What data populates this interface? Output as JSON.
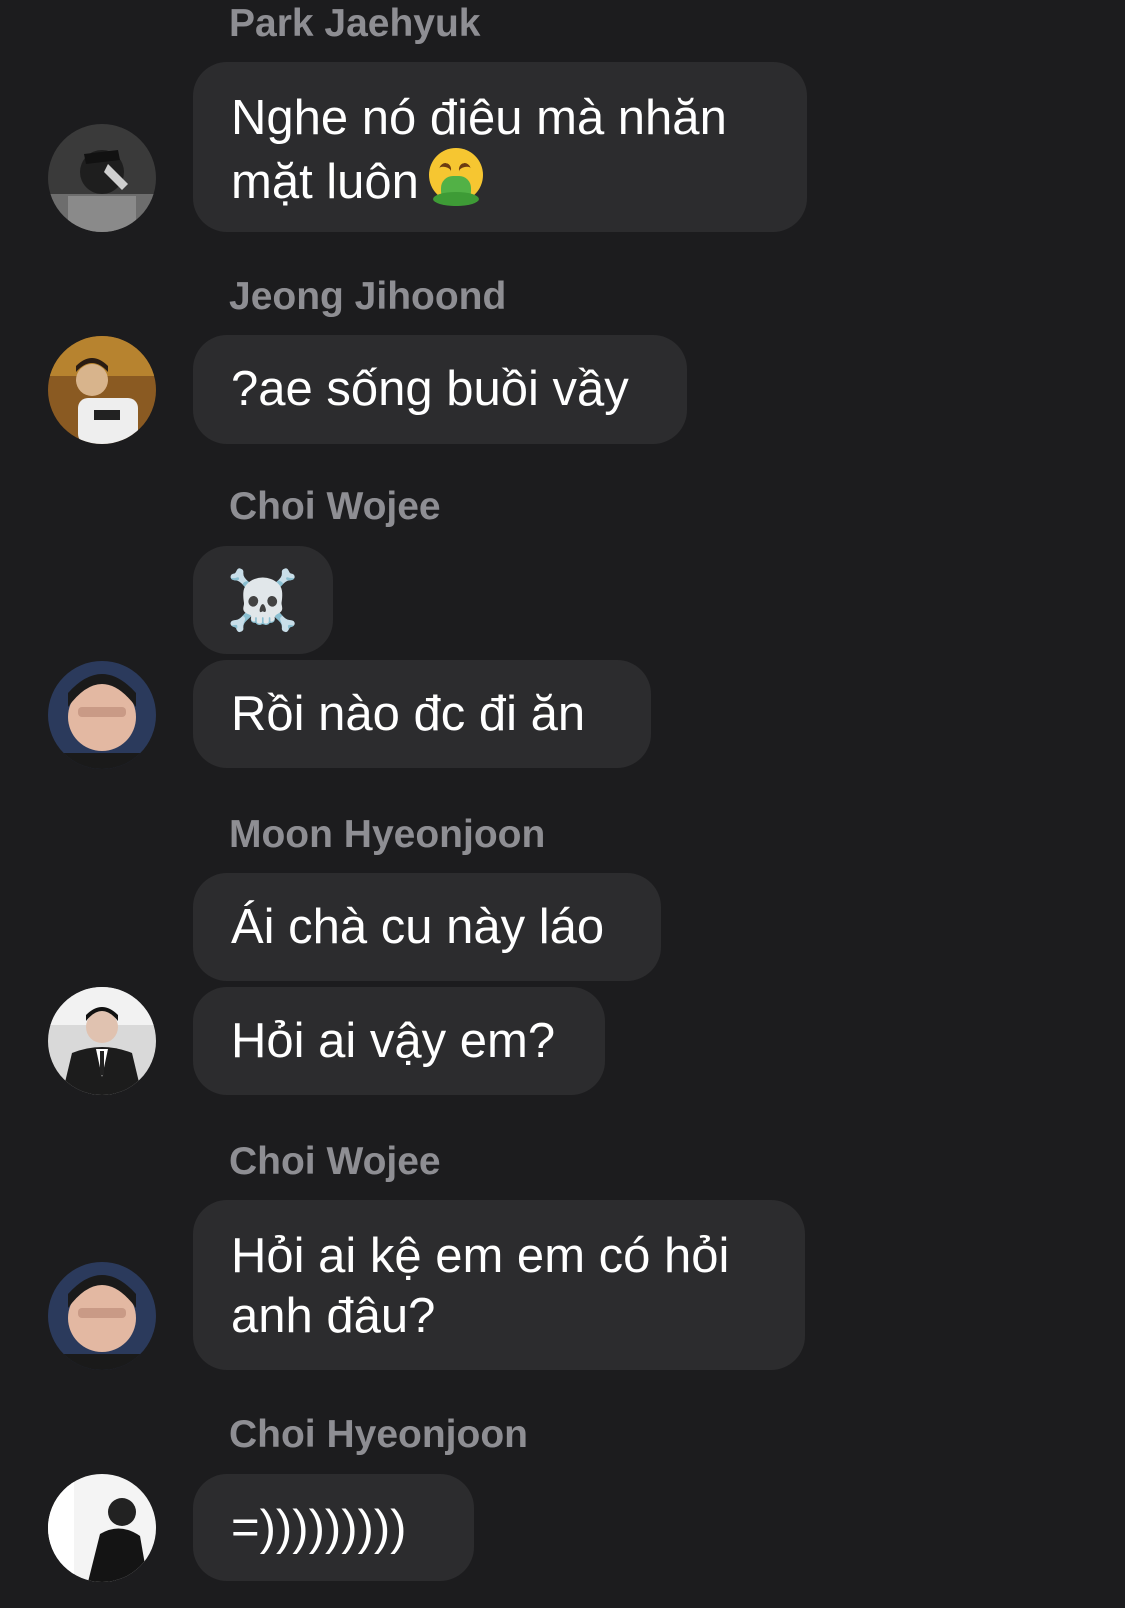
{
  "chat": {
    "groups": [
      {
        "sender": "Park Jaehyuk",
        "avatar_icon": "avatar-park-jaehyuk",
        "messages": [
          "Nghe nó điêu mà nhăn",
          "mặt luôn"
        ],
        "emoji": "face-vomiting"
      },
      {
        "sender": "Jeong Jihoond",
        "avatar_icon": "avatar-jeong-jihoond",
        "messages": [
          "?ae sống buồi vầy"
        ]
      },
      {
        "sender": "Choi Wojee",
        "avatar_icon": "avatar-choi-wojee",
        "messages": [
          "☠️",
          "Rồi nào đc đi ăn"
        ]
      },
      {
        "sender": "Moon Hyeonjoon",
        "avatar_icon": "avatar-moon-hyeonjoon",
        "messages": [
          "Ái chà cu này láo",
          "Hỏi ai vậy em?"
        ]
      },
      {
        "sender": "Choi Wojee",
        "avatar_icon": "avatar-choi-wojee",
        "messages": [
          "Hỏi ai kệ em em có hỏi",
          "anh đâu?"
        ]
      },
      {
        "sender": "Choi Hyeonjoon",
        "avatar_icon": "avatar-choi-hyeonjoon",
        "messages": [
          "=)))))))))"
        ]
      }
    ],
    "colors": {
      "background": "#1c1c1e",
      "bubble": "#2c2c2e",
      "sender_name": "#8e8e93",
      "text": "#ffffff"
    }
  }
}
